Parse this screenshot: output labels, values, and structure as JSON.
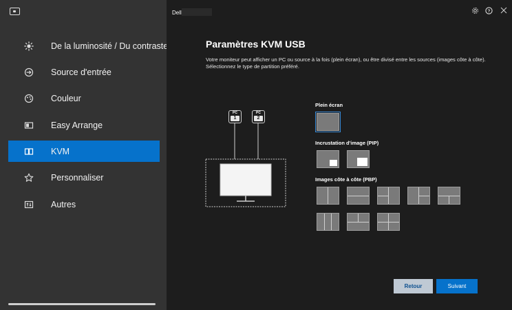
{
  "app": {
    "brand": "Dell",
    "icons": [
      "display-icon",
      "gear-icon",
      "help-icon",
      "close-icon"
    ]
  },
  "sidebar": {
    "items": [
      {
        "label": "De la luminosité / Du contraste",
        "icon": "brightness-icon",
        "active": false
      },
      {
        "label": "Source d'entrée",
        "icon": "input-source-icon",
        "active": false
      },
      {
        "label": "Couleur",
        "icon": "color-icon",
        "active": false
      },
      {
        "label": "Easy Arrange",
        "icon": "easy-arrange-icon",
        "active": false
      },
      {
        "label": "KVM",
        "icon": "kvm-icon",
        "active": true
      },
      {
        "label": "Personnaliser",
        "icon": "star-icon",
        "active": false
      },
      {
        "label": "Autres",
        "icon": "others-icon",
        "active": false
      }
    ]
  },
  "main": {
    "title": "Paramètres KVM USB",
    "description": "Votre moniteur peut afficher un PC ou source à la fois (plein écran), ou être divisé entre les sources (images côte à côte). Sélectionnez le type de partition préféré.",
    "diagram": {
      "pc1_top": "PC",
      "pc1_num": "1",
      "pc2_top": "PC",
      "pc2_num": "2"
    },
    "sections": {
      "full": "Plein écran",
      "pip": "Incrustation d'image (PIP)",
      "pbp": "Images côte à côte (PBP)"
    },
    "selected_layout": "full-screen",
    "buttons": {
      "back": "Retour",
      "next": "Suivant"
    }
  },
  "colors": {
    "accent": "#0672cb",
    "sidebar": "#333333",
    "main": "#1d1d1d"
  }
}
